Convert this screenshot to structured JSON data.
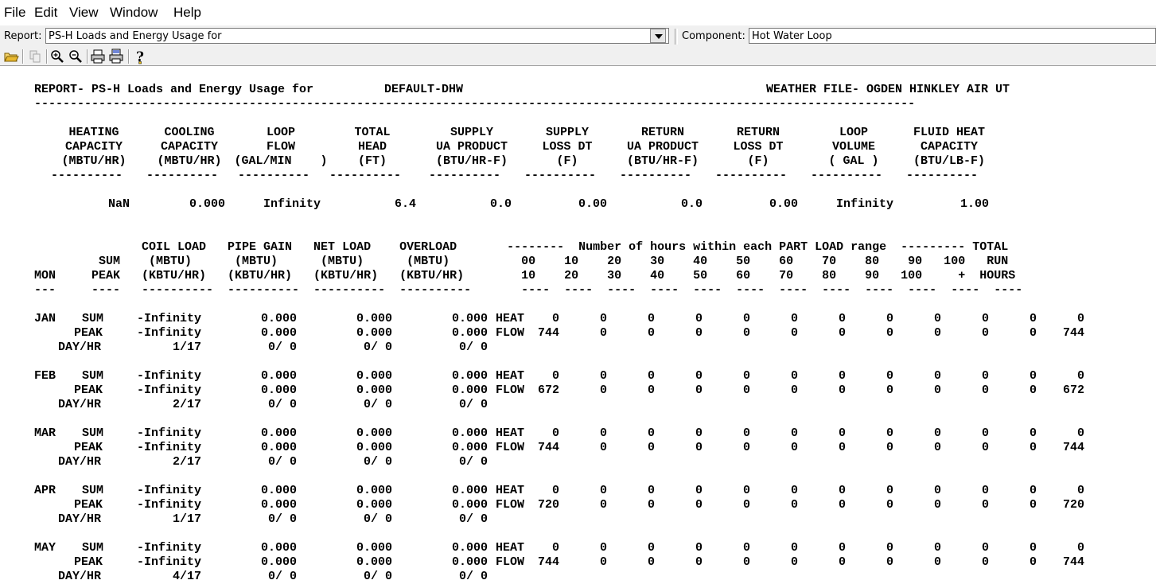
{
  "menu": [
    "File",
    "Edit",
    "View",
    "Window",
    "Help"
  ],
  "report": {
    "label": "Report:",
    "value": "PS-H Loads and Energy Usage for"
  },
  "component": {
    "label": "Component:",
    "value": "Hot Water Loop"
  },
  "toolbar_icons": [
    "open-folder-icon",
    "copy-icon",
    "zoom-in-icon",
    "zoom-out-icon",
    "print-icon",
    "print-preview-icon",
    "help-icon"
  ],
  "header": {
    "report_title": "REPORT- PS-H Loads and Energy Usage for",
    "loop_name": "DEFAULT-DHW",
    "weather_file": "WEATHER FILE- OGDEN HINKLEY AIR UT",
    "rule": "---------------------------------------------------------------------------------------------------------------------------"
  },
  "summary": {
    "columns": [
      {
        "l1": "HEATING",
        "l2": "CAPACITY",
        "l3": "(MBTU/HR)",
        "value": "NaN"
      },
      {
        "l1": "COOLING",
        "l2": "CAPACITY",
        "l3": "(MBTU/HR)",
        "value": "0.000"
      },
      {
        "l1": "LOOP",
        "l2": "FLOW",
        "l3": "(GAL/MIN    )",
        "value": "Infinity"
      },
      {
        "l1": "TOTAL",
        "l2": "HEAD",
        "l3": "(FT)",
        "value": "6.4"
      },
      {
        "l1": "SUPPLY",
        "l2": "UA PRODUCT",
        "l3": "(BTU/HR-F)",
        "value": "0.0"
      },
      {
        "l1": "SUPPLY",
        "l2": "LOSS DT",
        "l3": "(F)",
        "value": "0.00"
      },
      {
        "l1": "RETURN",
        "l2": "UA PRODUCT",
        "l3": "(BTU/HR-F)",
        "value": "0.0"
      },
      {
        "l1": "RETURN",
        "l2": "LOSS DT",
        "l3": "(F)",
        "value": "0.00"
      },
      {
        "l1": "LOOP",
        "l2": "VOLUME",
        "l3": "( GAL )",
        "value": "Infinity"
      },
      {
        "l1": "FLUID HEAT",
        "l2": "CAPACITY",
        "l3": "(BTU/LB-F)",
        "value": "1.00"
      }
    ],
    "dash": "----------"
  },
  "monthly": {
    "header_lines": [
      "               COIL LOAD   PIPE GAIN   NET LOAD    OVERLOAD       --------  Number of hours within each PART LOAD range  --------- TOTAL",
      "         SUM    (MBTU)      (MBTU)      (MBTU)      (MBTU)          00    10    20    30    40    50    60    70    80    90   100   RUN",
      "MON     PEAK   (KBTU/HR)   (KBTU/HR)   (KBTU/HR)   (KBTU/HR)        10    20    30    40    50    60    70    80    90   100     +  HOURS",
      "---     ----   ----------  ----------  ----------  ----------       ----  ----  ----  ----  ----  ----  ----  ----  ----  ----  ----  ----"
    ],
    "rows": [
      {
        "mon": "JAN",
        "coil_sum": "-Infinity",
        "coil_peak": "-Infinity",
        "coil_day": "1/17",
        "pipe_sum": "0.000",
        "pipe_peak": "0.000",
        "pipe_day": "0/ 0",
        "net_sum": "0.000",
        "net_peak": "0.000",
        "net_day": "0/ 0",
        "over_sum": "0.000",
        "over_peak": "0.000",
        "over_day": "0/ 0",
        "heat": [
          "0",
          "0",
          "0",
          "0",
          "0",
          "0",
          "0",
          "0",
          "0",
          "0",
          "0",
          "0"
        ],
        "flow": [
          "744",
          "0",
          "0",
          "0",
          "0",
          "0",
          "0",
          "0",
          "0",
          "0",
          "0",
          "744"
        ]
      },
      {
        "mon": "FEB",
        "coil_sum": "-Infinity",
        "coil_peak": "-Infinity",
        "coil_day": "2/17",
        "pipe_sum": "0.000",
        "pipe_peak": "0.000",
        "pipe_day": "0/ 0",
        "net_sum": "0.000",
        "net_peak": "0.000",
        "net_day": "0/ 0",
        "over_sum": "0.000",
        "over_peak": "0.000",
        "over_day": "0/ 0",
        "heat": [
          "0",
          "0",
          "0",
          "0",
          "0",
          "0",
          "0",
          "0",
          "0",
          "0",
          "0",
          "0"
        ],
        "flow": [
          "672",
          "0",
          "0",
          "0",
          "0",
          "0",
          "0",
          "0",
          "0",
          "0",
          "0",
          "672"
        ]
      },
      {
        "mon": "MAR",
        "coil_sum": "-Infinity",
        "coil_peak": "-Infinity",
        "coil_day": "2/17",
        "pipe_sum": "0.000",
        "pipe_peak": "0.000",
        "pipe_day": "0/ 0",
        "net_sum": "0.000",
        "net_peak": "0.000",
        "net_day": "0/ 0",
        "over_sum": "0.000",
        "over_peak": "0.000",
        "over_day": "0/ 0",
        "heat": [
          "0",
          "0",
          "0",
          "0",
          "0",
          "0",
          "0",
          "0",
          "0",
          "0",
          "0",
          "0"
        ],
        "flow": [
          "744",
          "0",
          "0",
          "0",
          "0",
          "0",
          "0",
          "0",
          "0",
          "0",
          "0",
          "744"
        ]
      },
      {
        "mon": "APR",
        "coil_sum": "-Infinity",
        "coil_peak": "-Infinity",
        "coil_day": "1/17",
        "pipe_sum": "0.000",
        "pipe_peak": "0.000",
        "pipe_day": "0/ 0",
        "net_sum": "0.000",
        "net_peak": "0.000",
        "net_day": "0/ 0",
        "over_sum": "0.000",
        "over_peak": "0.000",
        "over_day": "0/ 0",
        "heat": [
          "0",
          "0",
          "0",
          "0",
          "0",
          "0",
          "0",
          "0",
          "0",
          "0",
          "0",
          "0"
        ],
        "flow": [
          "720",
          "0",
          "0",
          "0",
          "0",
          "0",
          "0",
          "0",
          "0",
          "0",
          "0",
          "720"
        ]
      },
      {
        "mon": "MAY",
        "coil_sum": "-Infinity",
        "coil_peak": "-Infinity",
        "coil_day": "4/17",
        "pipe_sum": "0.000",
        "pipe_peak": "0.000",
        "pipe_day": "0/ 0",
        "net_sum": "0.000",
        "net_peak": "0.000",
        "net_day": "0/ 0",
        "over_sum": "0.000",
        "over_peak": "0.000",
        "over_day": "0/ 0",
        "heat": [
          "0",
          "0",
          "0",
          "0",
          "0",
          "0",
          "0",
          "0",
          "0",
          "0",
          "0",
          "0"
        ],
        "flow": [
          "744",
          "0",
          "0",
          "0",
          "0",
          "0",
          "0",
          "0",
          "0",
          "0",
          "0",
          "744"
        ]
      }
    ],
    "labels": {
      "sum": "SUM",
      "peak": "PEAK",
      "dayhr": "DAY/HR",
      "heat": "HEAT",
      "flow": "FLOW"
    }
  }
}
